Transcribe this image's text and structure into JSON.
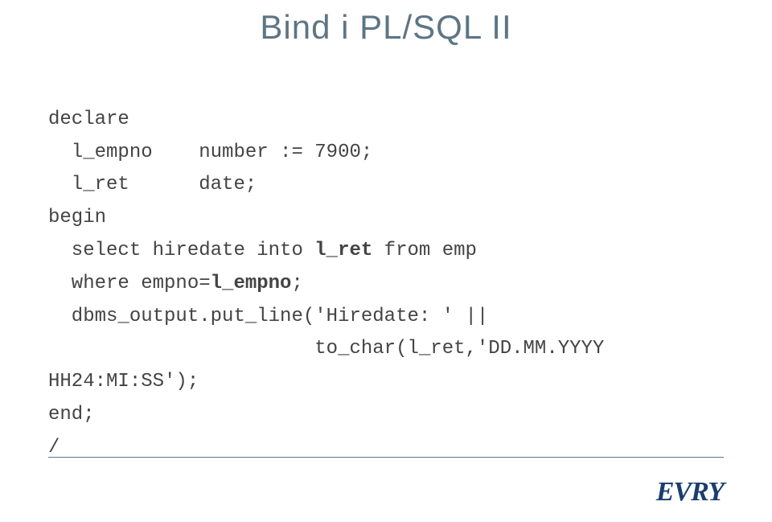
{
  "slide": {
    "title": "Bind i PL/SQL II"
  },
  "code": {
    "line1": "declare",
    "line2a": "  l_empno",
    "line2b": "number := 7900;",
    "line3a": "  l_ret",
    "line3b": "date;",
    "line4": "begin",
    "line5a": "  select hiredate into ",
    "line5b": "l_ret",
    "line5c": " from emp",
    "line6a": "  where empno=",
    "line6b": "l_empno",
    "line6c": ";",
    "line7": "  dbms_output.put_line('Hiredate: ' ||",
    "line8": "to_char(l_ret,'DD.MM.YYYY",
    "line9": "HH24:MI:SS');",
    "line10": "end;",
    "line11": "/"
  },
  "branding": {
    "logo": "EVRY"
  }
}
